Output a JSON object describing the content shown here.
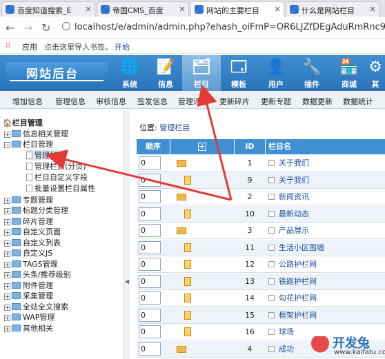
{
  "browser": {
    "tabs": [
      {
        "label": "百度知道搜索_E",
        "active": false
      },
      {
        "label": "帝国CMS_百度",
        "active": false
      },
      {
        "label": "网站的主要栏目",
        "active": true
      },
      {
        "label": "什么是网站栏目",
        "active": false
      }
    ],
    "url": "localhost/e/admin/admin.php?ehash_oiFmP=OR6LJZfDEgAduRmRnc9w",
    "bookmarks": {
      "apps": "应用",
      "import_hint": "点击这里导入书签。",
      "start": "开始"
    }
  },
  "header": {
    "logo": "网站后台",
    "nav": [
      {
        "label": "系统",
        "icon": "globe-icon"
      },
      {
        "label": "信息",
        "icon": "notepad-icon"
      },
      {
        "label": "栏目",
        "icon": "folder-icon",
        "active": true
      },
      {
        "label": "模板",
        "icon": "window-icon"
      },
      {
        "label": "用户",
        "icon": "user-icon"
      },
      {
        "label": "插件",
        "icon": "tools-icon"
      },
      {
        "label": "商城",
        "icon": "shop-icon"
      },
      {
        "label": "其",
        "icon": "gear-icon"
      }
    ]
  },
  "submenu": [
    "增加信息",
    "管理信息",
    "审核信息",
    "签发信息",
    "管理评论",
    "更新碎片",
    "更新专题",
    "数据更新",
    "数据统计"
  ],
  "sidebar": {
    "root": "栏目管理",
    "groups": [
      {
        "label": "信息相关管理",
        "expanded": false
      },
      {
        "label": "栏目管理",
        "expanded": true,
        "children": [
          "管理栏目",
          "管理栏目(分页)",
          "栏目自定义字段",
          "批量设置栏目属性"
        ]
      },
      {
        "label": "专题管理"
      },
      {
        "label": "标题分类管理"
      },
      {
        "label": "碎片管理"
      },
      {
        "label": "自定义页面"
      },
      {
        "label": "自定义列表"
      },
      {
        "label": "自定义JS"
      },
      {
        "label": "TAGS管理"
      },
      {
        "label": "头条/推荐级别"
      },
      {
        "label": "附件管理"
      },
      {
        "label": "采集管理"
      },
      {
        "label": "全站全文搜索"
      },
      {
        "label": "WAP管理"
      },
      {
        "label": "其他相关"
      }
    ]
  },
  "main": {
    "breadcrumb_prefix": "位置:",
    "breadcrumb_link": "管理栏目",
    "columns": {
      "order": "顺序",
      "expand": "+",
      "id": "ID",
      "name": "栏目名"
    },
    "rows": [
      {
        "order": "0",
        "kind": "folder",
        "id": "1",
        "name": "关于我们",
        "indent": 0
      },
      {
        "order": "0",
        "kind": "doc",
        "id": "9",
        "name": "关于我们",
        "indent": 0
      },
      {
        "order": "0",
        "kind": "folder",
        "id": "2",
        "name": "新闻资讯",
        "indent": 0
      },
      {
        "order": "0",
        "kind": "doc",
        "id": "10",
        "name": "最新动态",
        "indent": 1
      },
      {
        "order": "0",
        "kind": "folder",
        "id": "3",
        "name": "产品展示",
        "indent": 0
      },
      {
        "order": "0",
        "kind": "doc",
        "id": "11",
        "name": "生活小区围墙",
        "indent": 1
      },
      {
        "order": "0",
        "kind": "doc",
        "id": "12",
        "name": "公路护栏网",
        "indent": 1
      },
      {
        "order": "0",
        "kind": "doc",
        "id": "13",
        "name": "铁路护栏网",
        "indent": 1
      },
      {
        "order": "0",
        "kind": "doc",
        "id": "14",
        "name": "勾花护栏网",
        "indent": 1
      },
      {
        "order": "0",
        "kind": "doc",
        "id": "15",
        "name": "框架护栏网",
        "indent": 1
      },
      {
        "order": "0",
        "kind": "doc",
        "id": "16",
        "name": "球场",
        "indent": 1
      },
      {
        "order": "0",
        "kind": "folder",
        "id": "4",
        "name": "成功",
        "indent": 0
      }
    ]
  },
  "watermark": {
    "brand": "开发兔",
    "domain": "www.kaifatu.com"
  },
  "colors": {
    "header": "#2a73b8",
    "annotation_arrow": "#e53935"
  }
}
